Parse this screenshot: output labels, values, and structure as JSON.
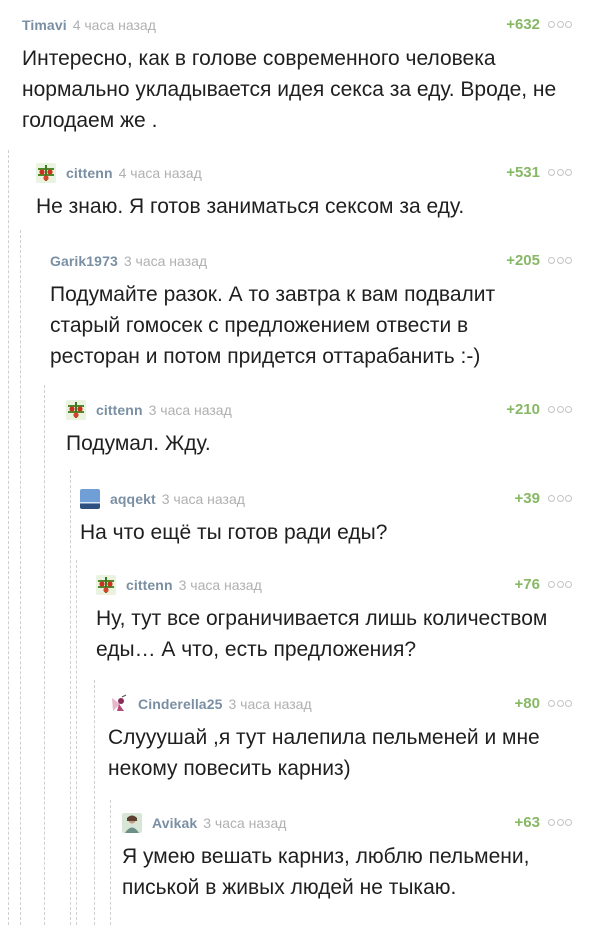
{
  "comments": [
    {
      "author": "Timavi",
      "time": "4 часа назад",
      "rating": "+632",
      "avatar": "none-icon",
      "text": "Интересно, как в голове современного человека\nнормально укладывается идея секса за еду. Вроде, не\nголодаем же ."
    },
    {
      "author": "cittenn",
      "time": "4 часа назад",
      "rating": "+531",
      "avatar": "tomato-plant-avatar-icon",
      "text": "Не знаю. Я готов заниматься сексом за еду."
    },
    {
      "author": "Garik1973",
      "time": "3 часа назад",
      "rating": "+205",
      "avatar": "none-icon",
      "text": "Подумайте разок. А то завтра к вам подвалит\nстарый гомосек с предложением отвести в\nресторан и потом придется оттарабанить :-)"
    },
    {
      "author": "cittenn",
      "time": "3 часа назад",
      "rating": "+210",
      "avatar": "tomato-plant-avatar-icon",
      "text": "Подумал. Жду."
    },
    {
      "author": "aqqekt",
      "time": "3 часа назад",
      "rating": "+39",
      "avatar": "landscape-avatar-icon",
      "text": "На что ещё ты готов ради еды?"
    },
    {
      "author": "cittenn",
      "time": "3 часа назад",
      "rating": "+76",
      "avatar": "tomato-plant-avatar-icon",
      "text": "Ну, тут все ограничивается лишь количеством\nеды… А что, есть предложения?"
    },
    {
      "author": "Cinderella25",
      "time": "3 часа назад",
      "rating": "+80",
      "avatar": "cartoon-character-avatar-icon",
      "text": "Слууушай ,я тут налепила пельменей и мне\nнекому повесить карниз)"
    },
    {
      "author": "Avikak",
      "time": "3 часа назад",
      "rating": "+63",
      "avatar": "person-photo-avatar-icon",
      "text": "Я умею вешать карниз, люблю пельмени,\nписькой в живых людей не тыкаю."
    }
  ],
  "colors": {
    "author": "#7a8fa3",
    "time": "#b0b0b0",
    "rating": "#86b865",
    "text": "#1f1f1f",
    "guide": "#cfcfcf"
  }
}
